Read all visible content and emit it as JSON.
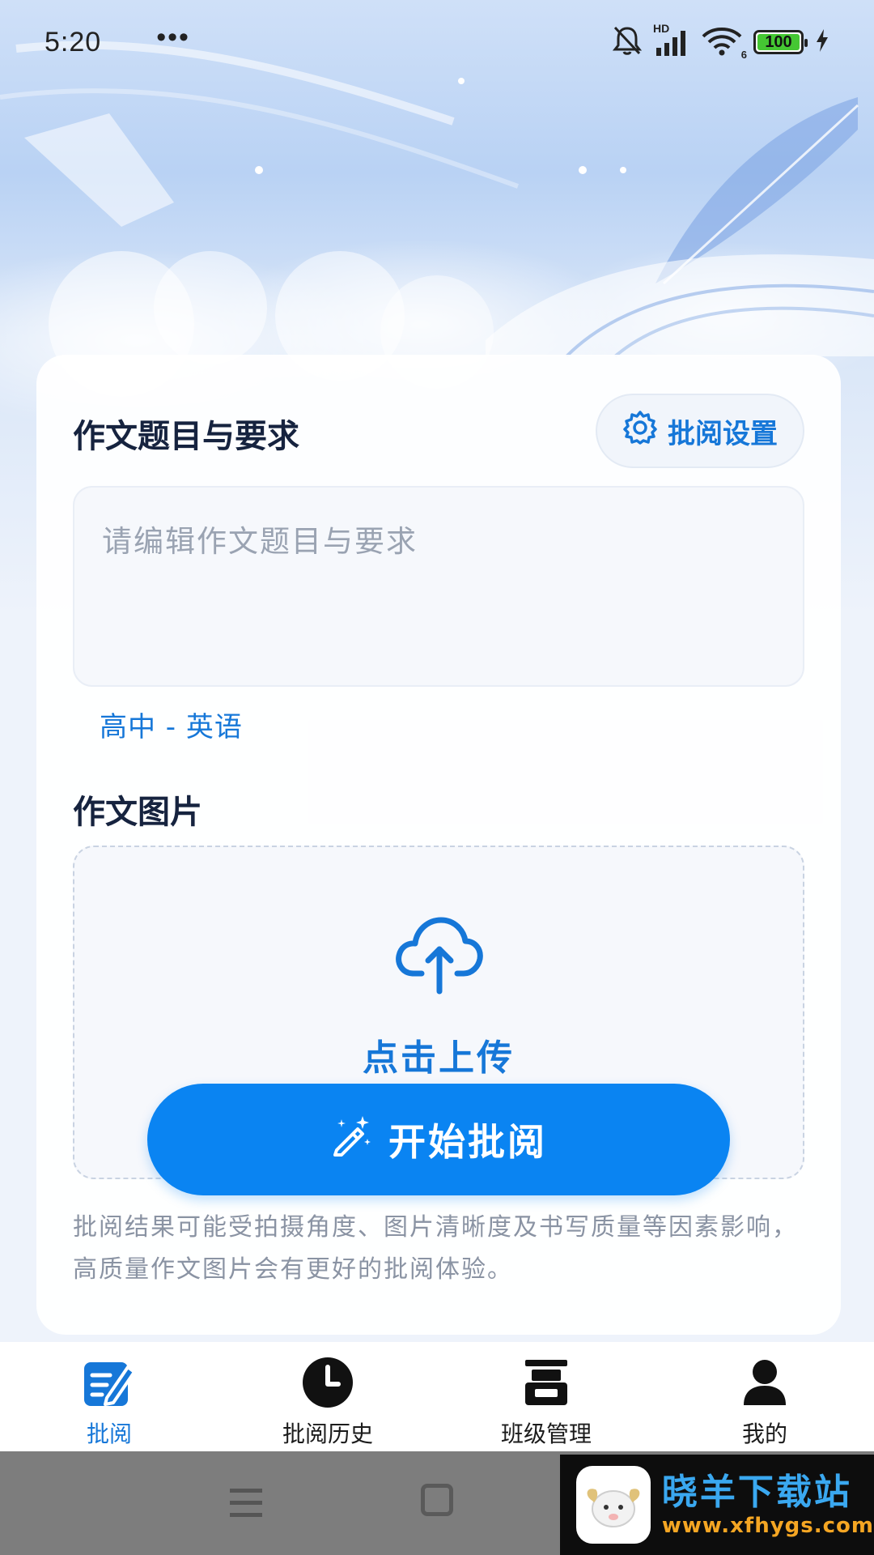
{
  "status_bar": {
    "time": "5:20",
    "dots": "•••",
    "network": "HD",
    "wifi_badge": "6",
    "battery": "100",
    "battery_level": 1.0
  },
  "card": {
    "topic_title": "作文题目与要求",
    "settings_button": "批阅设置",
    "topic_placeholder": "请编辑作文题目与要求",
    "grade_subject": "高中 - 英语",
    "image_title": "作文图片",
    "upload_label": "点击上传",
    "start_button": "开始批阅",
    "hint": "批阅结果可能受拍摄角度、图片清晰度及书写质量等因素影响，高质量作文图片会有更好的批阅体验。"
  },
  "tabs": [
    {
      "label": "批阅",
      "icon": "edit-icon",
      "active": true
    },
    {
      "label": "批阅历史",
      "icon": "clock-icon",
      "active": false
    },
    {
      "label": "班级管理",
      "icon": "class-icon",
      "active": false
    },
    {
      "label": "我的",
      "icon": "user-icon",
      "active": false
    }
  ],
  "watermark": {
    "title": "晓羊下载站",
    "url": "www.xfhygs.com"
  },
  "colors": {
    "accent": "#1677d8",
    "primary_button": "#0a84f2",
    "battery": "#45c733"
  }
}
